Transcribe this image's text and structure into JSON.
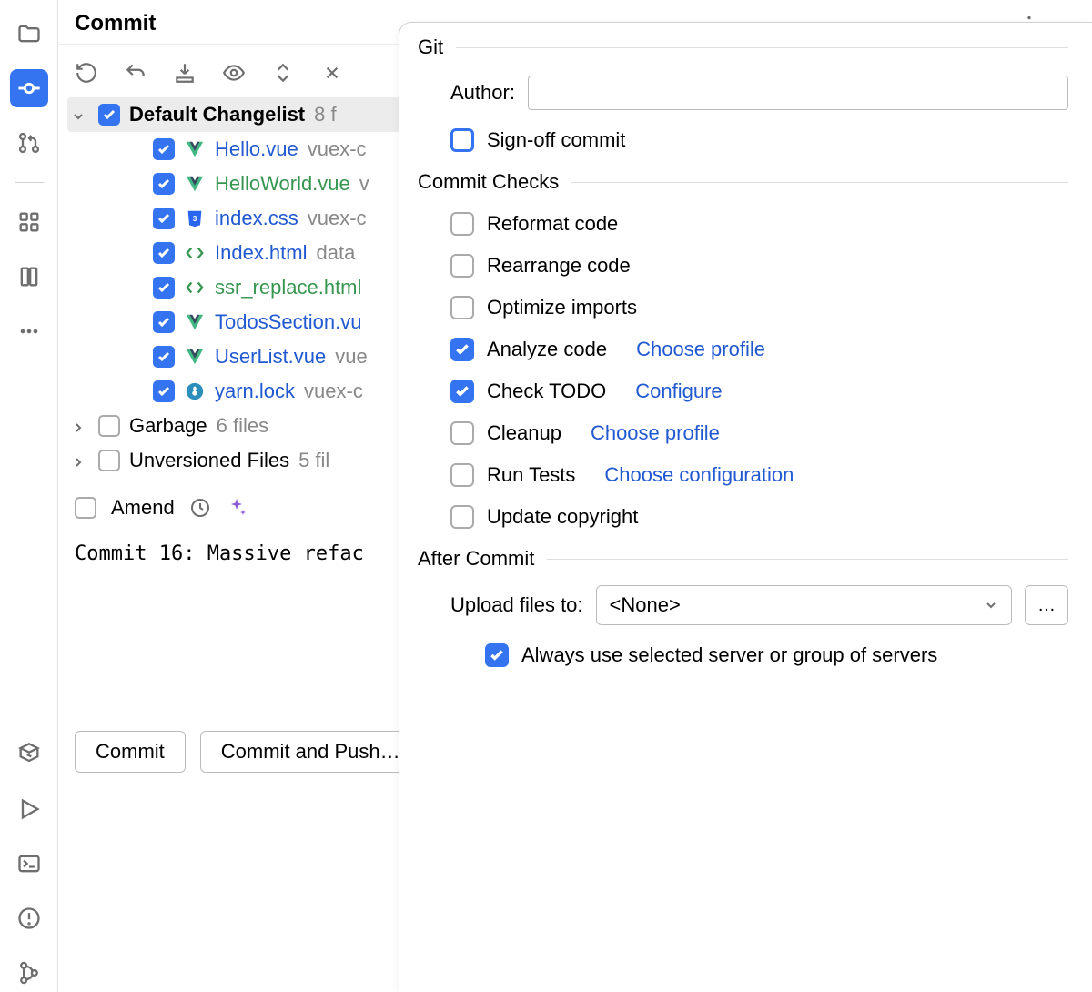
{
  "header": {
    "title": "Commit"
  },
  "tree": {
    "default_label": "Default Changelist",
    "default_count": "8 f",
    "files": [
      {
        "name": "Hello.vue",
        "color": "blue",
        "icon": "vue",
        "path": "vuex-c"
      },
      {
        "name": "HelloWorld.vue",
        "color": "green",
        "icon": "vue",
        "path": "v"
      },
      {
        "name": "index.css",
        "color": "blue",
        "icon": "css",
        "path": "vuex-c"
      },
      {
        "name": "Index.html",
        "color": "blue",
        "icon": "html",
        "path": "data"
      },
      {
        "name": "ssr_replace.html",
        "color": "green",
        "icon": "html",
        "path": ""
      },
      {
        "name": "TodosSection.vu",
        "color": "blue",
        "icon": "vue",
        "path": ""
      },
      {
        "name": "UserList.vue",
        "color": "blue",
        "icon": "vue",
        "path": "vue"
      },
      {
        "name": "yarn.lock",
        "color": "blue",
        "icon": "yarn",
        "path": "vuex-c"
      }
    ],
    "garbage_label": "Garbage",
    "garbage_count": "6 files",
    "unversioned_label": "Unversioned Files",
    "unversioned_count": "5 fil"
  },
  "meta": {
    "amend_label": "Amend"
  },
  "message": "Commit 16: Massive refac",
  "buttons": {
    "commit": "Commit",
    "commit_push": "Commit and Push…"
  },
  "options": {
    "git_title": "Git",
    "author_label": "Author:",
    "author_value": "",
    "signoff_label": "Sign-off commit",
    "checks_title": "Commit Checks",
    "reformat": "Reformat code",
    "rearrange": "Rearrange code",
    "optimize": "Optimize imports",
    "analyze": "Analyze code",
    "analyze_link": "Choose profile",
    "todo": "Check TODO",
    "todo_link": "Configure",
    "cleanup": "Cleanup",
    "cleanup_link": "Choose profile",
    "tests": "Run Tests",
    "tests_link": "Choose configuration",
    "copyright": "Update copyright",
    "after_title": "After Commit",
    "upload_label": "Upload files to:",
    "upload_value": "<None>",
    "always_label": "Always use selected server or group of servers"
  }
}
